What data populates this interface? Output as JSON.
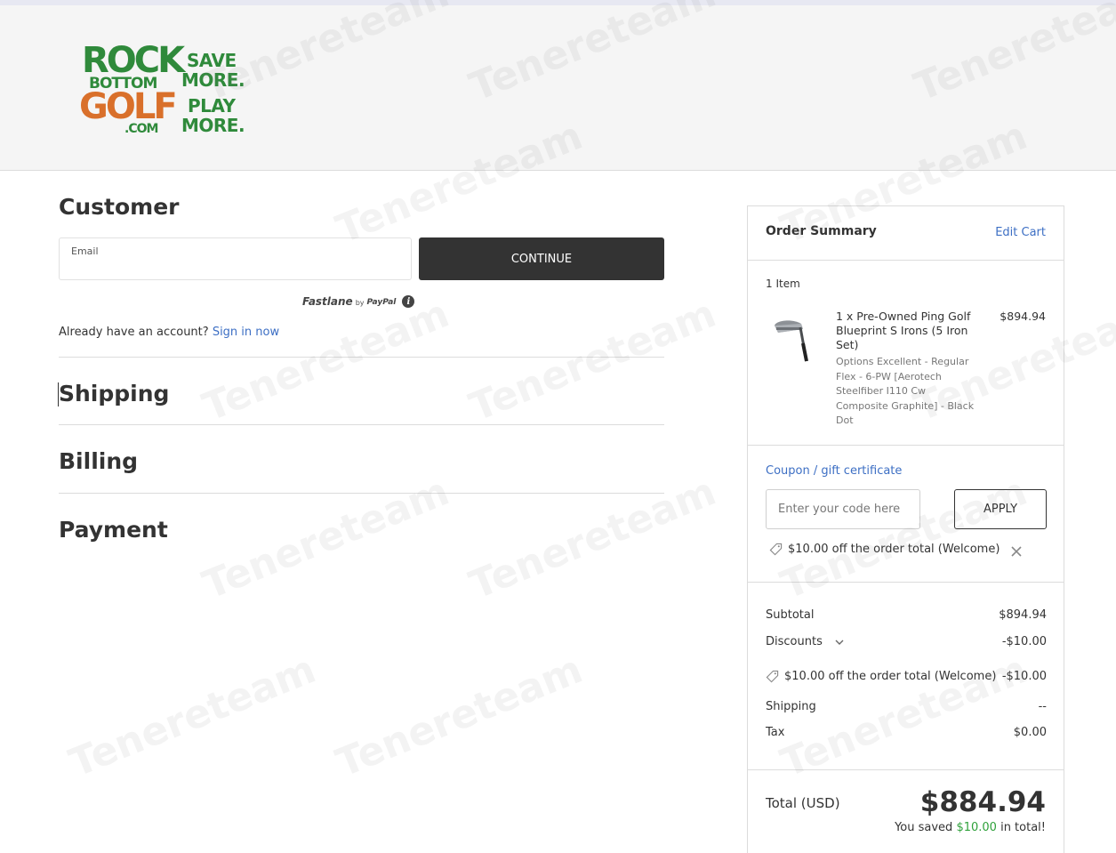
{
  "brand": {
    "logo_line1": "ROCK",
    "logo_line2": "BOTTOM",
    "logo_line3": "GOLF",
    "logo_line4": ".COM",
    "tagline": [
      "SAVE",
      "MORE.",
      "PLAY",
      "MORE."
    ],
    "colors": {
      "green": "#2f8a3b",
      "orange": "#d9702b"
    }
  },
  "customer": {
    "title": "Customer",
    "email_label": "Email",
    "email_value": "",
    "continue_label": "CONTINUE",
    "fastlane_text": "Fastlane",
    "fastlane_by": "by",
    "fastlane_paypal": "PayPal",
    "signin_prompt": "Already have an account?",
    "signin_link": "Sign in now"
  },
  "steps": {
    "shipping": "Shipping",
    "billing": "Billing",
    "payment": "Payment"
  },
  "summary": {
    "title": "Order Summary",
    "edit_cart": "Edit Cart",
    "item_count": "1 Item",
    "item": {
      "name": "1 x Pre-Owned Ping Golf Blueprint S Irons (5 Iron Set)",
      "price": "$894.94",
      "options": "Options Excellent - Regular Flex - 6-PW [Aerotech Steelfiber I110 Cw Composite Graphite] - Black Dot",
      "icon": "golf-iron-icon"
    },
    "coupon_link": "Coupon / gift certificate",
    "coupon_placeholder": "Enter your code here",
    "apply_label": "APPLY",
    "applied_coupon": "$10.00 off the order total (Welcome)",
    "subtotal_label": "Subtotal",
    "subtotal_value": "$894.94",
    "discounts_label": "Discounts",
    "discounts_value": "-$10.00",
    "discount_detail_label": "$10.00 off the order total (Welcome)",
    "discount_detail_value": "-$10.00",
    "shipping_label": "Shipping",
    "shipping_value": "--",
    "tax_label": "Tax",
    "tax_value": "$0.00",
    "total_label": "Total (USD)",
    "total_value": "$884.94",
    "saved_prefix": "You saved",
    "saved_amount": "$10.00",
    "saved_suffix": "in total!",
    "colors": {
      "link": "#3d6fc4",
      "saved": "#2fa13b",
      "button_dark": "#333333"
    }
  },
  "watermark": "Tenereteam"
}
